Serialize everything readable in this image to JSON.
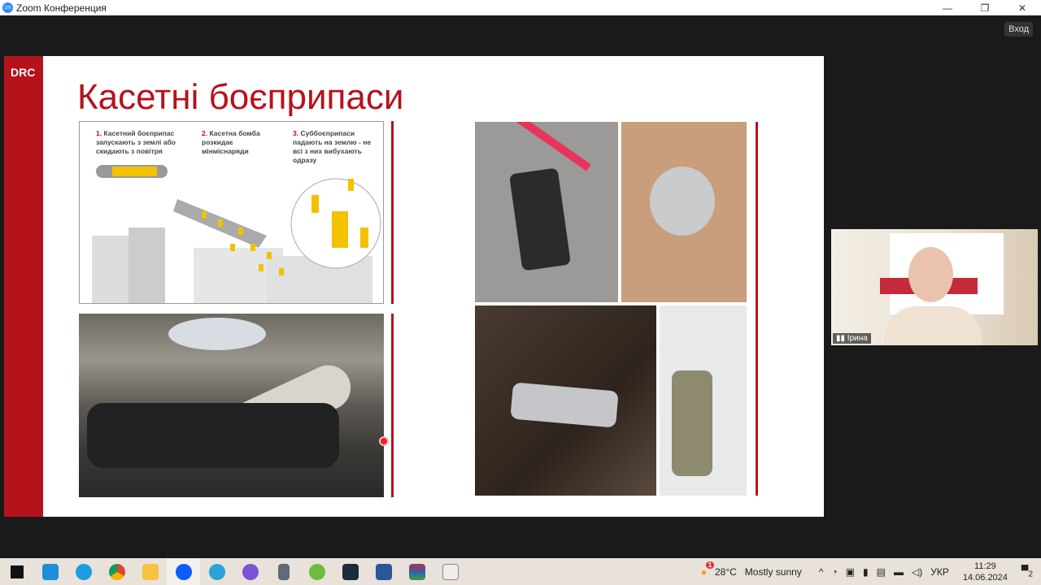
{
  "window": {
    "title": "Zoom Конференция",
    "exit_label": "Вход"
  },
  "slide": {
    "logo": "DRC",
    "title": "Касетні боєприпаси",
    "steps": [
      {
        "num": "1.",
        "text": "Касетний боєприпас запускають з землі або скидають з повітря"
      },
      {
        "num": "2.",
        "text": "Касетна бомба розкидає мінміснаряди"
      },
      {
        "num": "3.",
        "text": "Суббоєприпаси падають на землю - не всі з них вибухають одразу"
      }
    ]
  },
  "participant": {
    "name": "Ірина"
  },
  "taskbar": {
    "apps": [
      "start",
      "mail",
      "edge",
      "chrome",
      "explorer",
      "zoom",
      "telegram",
      "viber",
      "calculator",
      "utorrent",
      "vpn",
      "word",
      "winrar",
      "media-player"
    ],
    "weather_temp": "28°C",
    "weather_text": "Mostly sunny",
    "weather_badge": "1",
    "language": "УКР",
    "time": "11:29",
    "date": "14.06.2024",
    "notifications": "2"
  }
}
